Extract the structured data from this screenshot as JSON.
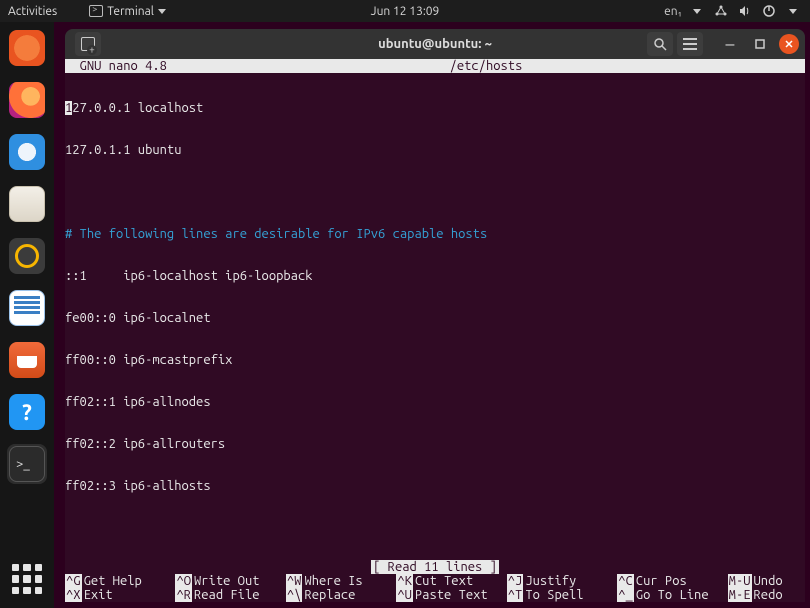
{
  "topbar": {
    "activities": "Activities",
    "app_name": "Terminal",
    "datetime": "Jun 12  13:09",
    "lang": "en₁"
  },
  "window": {
    "title": "ubuntu@ubuntu: ~"
  },
  "nano": {
    "header_left": "  GNU nano 4.8",
    "header_file": "/etc/hosts",
    "lines": {
      "l1a": "1",
      "l1b": "27.0.0.1 localhost",
      "l2": "127.0.1.1 ubuntu",
      "blank": "",
      "comment": "# The following lines are desirable for IPv6 capable hosts",
      "l4": "::1     ip6-localhost ip6-loopback",
      "l5": "fe00::0 ip6-localnet",
      "l6": "ff00::0 ip6-mcastprefix",
      "l7": "ff02::1 ip6-allnodes",
      "l8": "ff02::2 ip6-allrouters",
      "l9": "ff02::3 ip6-allhosts"
    },
    "status": "[ Read 11 lines ]",
    "shortcuts": [
      {
        "key": "^G",
        "label": "Get Help"
      },
      {
        "key": "^O",
        "label": "Write Out"
      },
      {
        "key": "^W",
        "label": "Where Is"
      },
      {
        "key": "^K",
        "label": "Cut Text"
      },
      {
        "key": "^J",
        "label": "Justify"
      },
      {
        "key": "^C",
        "label": "Cur Pos"
      },
      {
        "key": "M-U",
        "label": "Undo"
      },
      {
        "key": "^X",
        "label": "Exit"
      },
      {
        "key": "^R",
        "label": "Read File"
      },
      {
        "key": "^\\",
        "label": "Replace"
      },
      {
        "key": "^U",
        "label": "Paste Text"
      },
      {
        "key": "^T",
        "label": "To Spell"
      },
      {
        "key": "^_",
        "label": "Go To Line"
      },
      {
        "key": "M-E",
        "label": "Redo"
      }
    ]
  },
  "dock": {
    "items": [
      "ubuntu-swirl",
      "firefox",
      "thunderbird",
      "files",
      "rhythmbox",
      "libreoffice-writer",
      "ubuntu-software",
      "help",
      "terminal"
    ]
  }
}
